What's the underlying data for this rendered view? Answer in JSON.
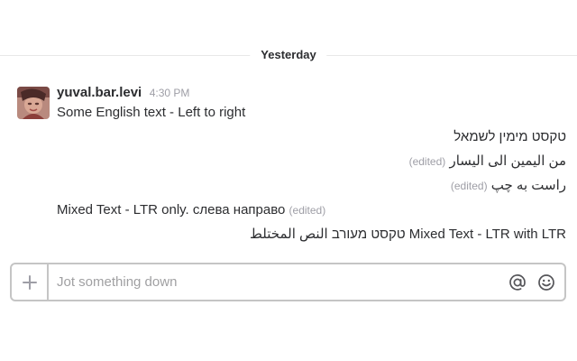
{
  "divider": {
    "label": "Yesterday"
  },
  "message": {
    "username": "yuval.bar.levi",
    "timestamp": "4:30 PM",
    "avatar_icon": "user-avatar-photo"
  },
  "lines": [
    {
      "text": "Some English text - Left to right",
      "direction": "ltr",
      "edited": ""
    },
    {
      "text": "טקסט מימין לשמאל",
      "direction": "rtl",
      "edited": ""
    },
    {
      "text": "من اليمين الى اليسار",
      "direction": "rtl",
      "edited": "(edited)"
    },
    {
      "text": "راست به چپ",
      "direction": "rtl",
      "edited": "(edited)"
    },
    {
      "text": "Mixed Text - LTR only. слева направо",
      "direction": "ltr",
      "edited": "(edited)"
    },
    {
      "text": "Mixed Text - LTR with LTR טקסט מעורב النص المختلط",
      "direction": "rtl",
      "edited": ""
    }
  ],
  "composer": {
    "placeholder": "Jot something down",
    "value": "",
    "plus_icon": "plus-icon",
    "mention_icon": "at-sign-icon",
    "emoji_icon": "smiley-icon"
  },
  "colors": {
    "text": "#2c2d30",
    "muted": "#9e9ea6",
    "border": "#c5c5c5",
    "divider": "#e8e8e8"
  }
}
